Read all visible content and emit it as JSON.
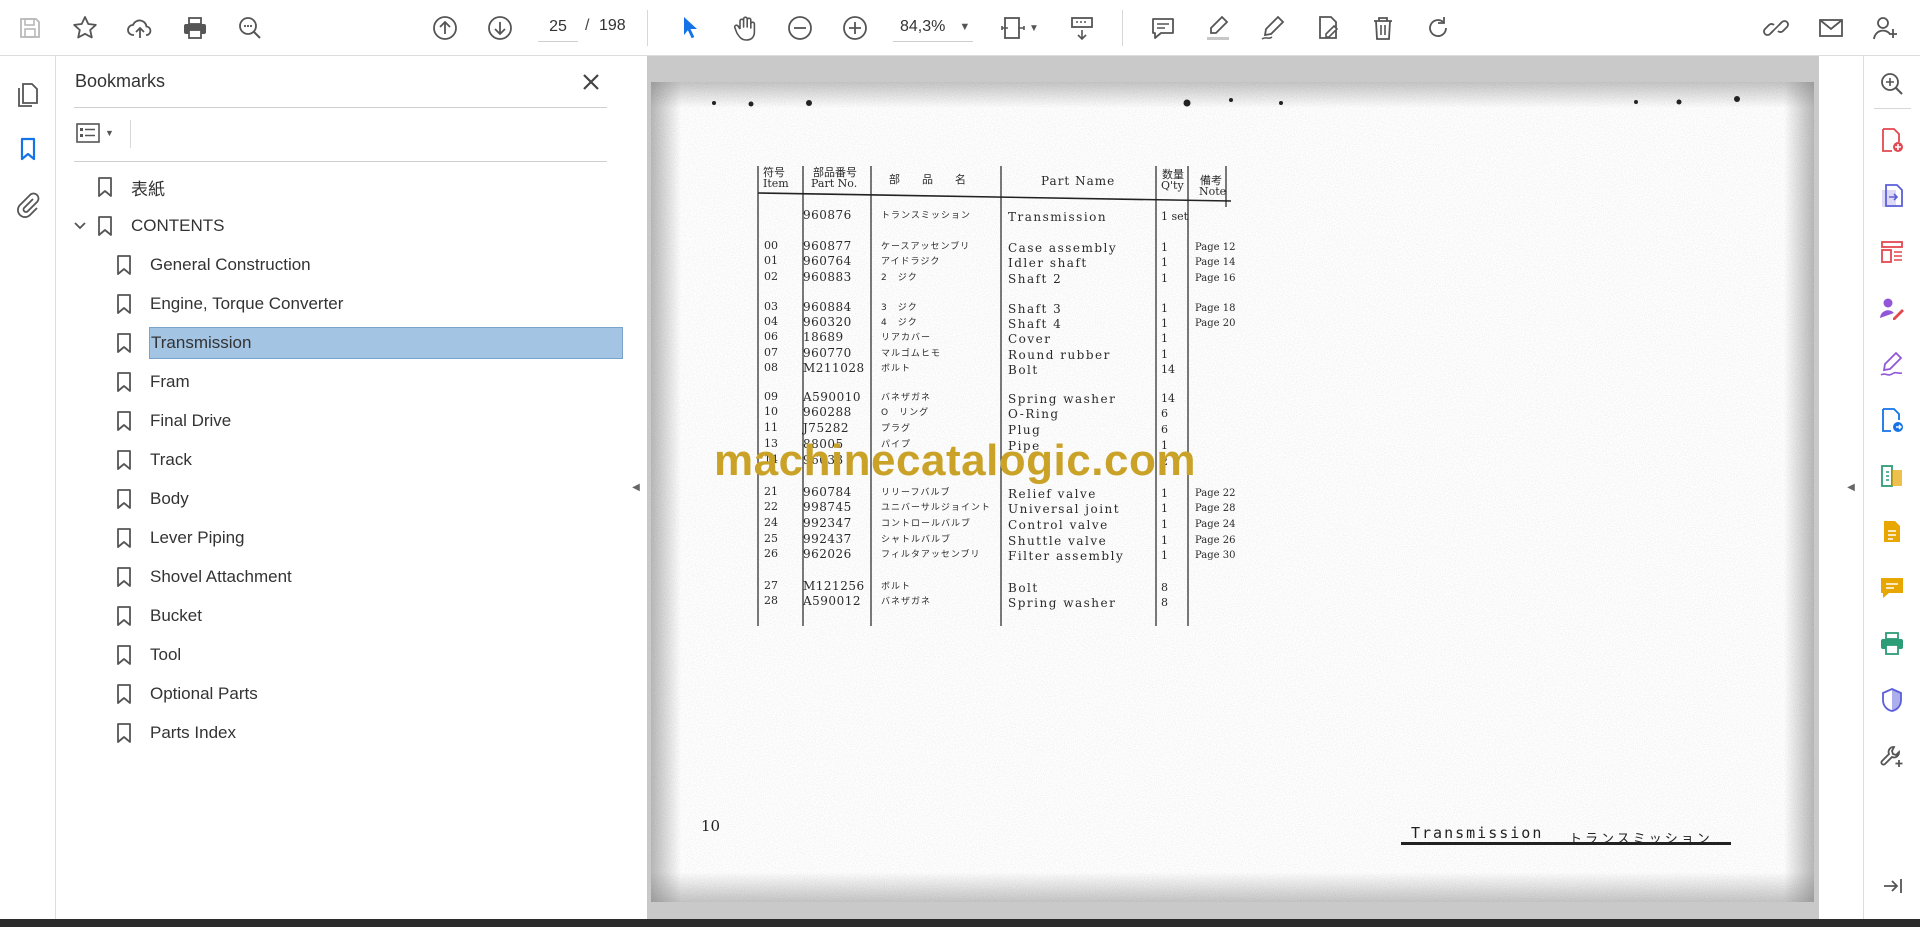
{
  "toolbar": {
    "current_page": "25",
    "page_separator": "/",
    "total_pages": "198",
    "zoom": "84,3%"
  },
  "bookmarks": {
    "title": "Bookmarks",
    "items": [
      {
        "label": "表紙",
        "level": 0
      },
      {
        "label": "CONTENTS",
        "level": 0
      },
      {
        "label": "General Construction",
        "level": 1
      },
      {
        "label": "Engine, Torque Converter",
        "level": 1
      },
      {
        "label": "Transmission",
        "level": 1,
        "selected": true
      },
      {
        "label": "Fram",
        "level": 1
      },
      {
        "label": "Final Drive",
        "level": 1
      },
      {
        "label": "Track",
        "level": 1
      },
      {
        "label": "Body",
        "level": 1
      },
      {
        "label": "Lever Piping",
        "level": 1
      },
      {
        "label": "Shovel Attachment",
        "level": 1
      },
      {
        "label": "Bucket",
        "level": 1
      },
      {
        "label": "Tool",
        "level": 1
      },
      {
        "label": "Optional Parts",
        "level": 1
      },
      {
        "label": "Parts Index",
        "level": 1
      }
    ]
  },
  "document": {
    "watermark": "machinecatalogic.com",
    "page_number": "10",
    "footer_title": "Transmission",
    "footer_title_jp": "トランスミッション",
    "table": {
      "headers": {
        "item_jp": "符号",
        "item": "Item",
        "partno_jp": "部品番号",
        "partno": "Part No.",
        "name_jp": "部　　品　　名",
        "name": "Part Name",
        "qty_jp": "数量",
        "qty": "Q'ty",
        "note_jp": "備考",
        "note": "Note"
      },
      "rows": [
        {
          "item": "",
          "partno": "960876",
          "jp": "トランスミッション",
          "name": "Transmission",
          "qty": "1 set",
          "note": ""
        },
        {
          "item": "00",
          "partno": "960877",
          "jp": "ケースアッセンブリ",
          "name": "Case assembly",
          "qty": "1",
          "note": "Page 12"
        },
        {
          "item": "01",
          "partno": "960764",
          "jp": "アイドラジク",
          "name": "Idler shaft",
          "qty": "1",
          "note": "Page 14"
        },
        {
          "item": "02",
          "partno": "960883",
          "jp": "2　ジク",
          "name": "Shaft 2",
          "qty": "1",
          "note": "Page 16"
        },
        {
          "item": "03",
          "partno": "960884",
          "jp": "3　ジク",
          "name": "Shaft 3",
          "qty": "1",
          "note": "Page 18"
        },
        {
          "item": "04",
          "partno": "960320",
          "jp": "4　ジク",
          "name": "Shaft 4",
          "qty": "1",
          "note": "Page 20"
        },
        {
          "item": "06",
          "partno": "18689",
          "jp": "リアカバー",
          "name": "Cover",
          "qty": "1",
          "note": ""
        },
        {
          "item": "07",
          "partno": "960770",
          "jp": "マルゴムヒモ",
          "name": "Round rubber",
          "qty": "1",
          "note": ""
        },
        {
          "item": "08",
          "partno": "M211028",
          "jp": "ボルト",
          "name": "Bolt",
          "qty": "14",
          "note": ""
        },
        {
          "item": "09",
          "partno": "A590010",
          "jp": "バネザガネ",
          "name": "Spring washer",
          "qty": "14",
          "note": ""
        },
        {
          "item": "10",
          "partno": "960288",
          "jp": "O　リング",
          "name": "O-Ring",
          "qty": "6",
          "note": ""
        },
        {
          "item": "11",
          "partno": "J75282",
          "jp": "プラグ",
          "name": "Plug",
          "qty": "6",
          "note": ""
        },
        {
          "item": "13",
          "partno": "88005",
          "jp": "パイプ",
          "name": "Pipe",
          "qty": "1",
          "note": ""
        },
        {
          "item": "14",
          "partno": "96033",
          "jp": "",
          "name": "",
          "qty": "2",
          "note": ""
        },
        {
          "item": "21",
          "partno": "960784",
          "jp": "リリーフバルブ",
          "name": "Relief valve",
          "qty": "1",
          "note": "Page 22"
        },
        {
          "item": "22",
          "partno": "998745",
          "jp": "ユニバーサルジョイント",
          "name": "Universal joint",
          "qty": "1",
          "note": "Page 28"
        },
        {
          "item": "24",
          "partno": "992347",
          "jp": "コントロールバルブ",
          "name": "Control valve",
          "qty": "1",
          "note": "Page 24"
        },
        {
          "item": "25",
          "partno": "992437",
          "jp": "シャトルバルブ",
          "name": "Shuttle valve",
          "qty": "1",
          "note": "Page 26"
        },
        {
          "item": "26",
          "partno": "962026",
          "jp": "フィルタアッセンブリ",
          "name": "Filter assembly",
          "qty": "1",
          "note": "Page 30"
        },
        {
          "item": "27",
          "partno": "M121256",
          "jp": "ボルト",
          "name": "Bolt",
          "qty": "8",
          "note": ""
        },
        {
          "item": "28",
          "partno": "A590012",
          "jp": "バネザガネ",
          "name": "Spring washer",
          "qty": "8",
          "note": ""
        }
      ]
    }
  },
  "colors": {
    "accent_blue": "#1473e6",
    "selection": "#a3c4e3",
    "watermark": "#c9a227",
    "tool_pink": "#e34850",
    "tool_purple": "#9256d9",
    "tool_green": "#2d9d78",
    "tool_yellow": "#e8a600"
  }
}
